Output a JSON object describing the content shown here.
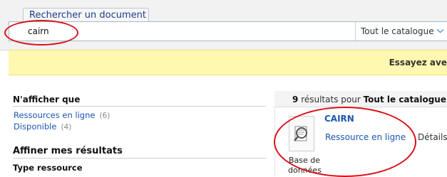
{
  "search": {
    "tab_label": "Rechercher un document",
    "query": "cairn",
    "scope_label": "Tout le catalogue",
    "scope_icon": "chevron-down-icon"
  },
  "banner": {
    "text": "Essayez ave"
  },
  "facets": {
    "filter_title": "N'afficher que",
    "items": [
      {
        "label": "Ressources en ligne",
        "count": "(6)"
      },
      {
        "label": "Disponible",
        "count": "(4)"
      }
    ],
    "refine_title": "Affiner mes résultats",
    "type_title": "Type ressource"
  },
  "results": {
    "count": "9",
    "count_text": "résultats pour",
    "scope": "Tout le catalogue",
    "item": {
      "title": "CAIRN",
      "availability_link": "Ressource en ligne",
      "details_link": "Détails",
      "type_line1": "Base de",
      "type_line2": "données",
      "thumb_icon": "magnifier-document-icon"
    }
  },
  "annotation_color": "#d8111b"
}
